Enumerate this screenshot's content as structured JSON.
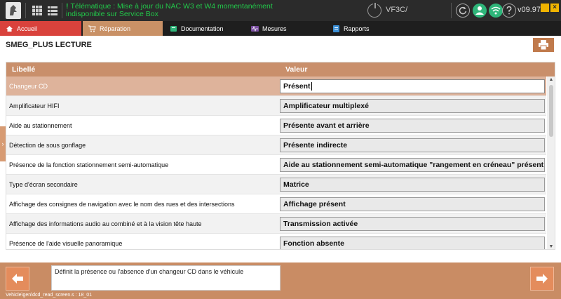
{
  "topbar": {
    "message": "Télématique : Mise à jour du NAC W3 et W4 momentanément indisponible sur Service Box",
    "message_prefix": "!",
    "vin": "VF3C/",
    "version": "v09.97",
    "close_glyph": "×",
    "icons": [
      "peugeot-logo",
      "grid-icon",
      "list-icon",
      "power-icon",
      "refresh-icon",
      "user-icon",
      "wifi-icon",
      "help-icon"
    ]
  },
  "tabs": [
    {
      "label": "Accueil",
      "icon": "home-icon",
      "active": false
    },
    {
      "label": "Réparation",
      "icon": "cart-icon",
      "active": true
    },
    {
      "label": "Documentation",
      "icon": "book-icon",
      "active": false
    },
    {
      "label": "Mesures",
      "icon": "waveform-icon",
      "active": false
    },
    {
      "label": "Rapports",
      "icon": "report-icon",
      "active": false
    }
  ],
  "page": {
    "title": "SMEG_PLUS LECTURE"
  },
  "table": {
    "headers": [
      "Libellé",
      "Valeur"
    ],
    "rows": [
      {
        "label": "Changeur CD",
        "value": "Présent"
      },
      {
        "label": "Amplificateur HIFI",
        "value": "Amplificateur multiplexé"
      },
      {
        "label": "Aide au stationnement",
        "value": "Présente avant et arrière"
      },
      {
        "label": "Détection de sous gonflage",
        "value": "Présente indirecte"
      },
      {
        "label": "Présence de la fonction stationnement semi-automatique",
        "value": "Aide au stationnement semi-automatique \"rangement en créneau\" présent"
      },
      {
        "label": "Type d'écran secondaire",
        "value": "Matrice"
      },
      {
        "label": "Affichage des consignes de navigation avec le nom des rues et des intersections",
        "value": "Affichage présent"
      },
      {
        "label": "Affichage des informations audio au combiné et à la vision tête haute",
        "value": "Transmission activée"
      },
      {
        "label": "Présence de l'aide visuelle panoramique",
        "value": "Fonction absente"
      }
    ]
  },
  "footer": {
    "help_text": "Définit la présence ou l'absence d'un changeur CD dans le véhicule",
    "path": "Vehicle\\gen\\dcd_read_screen.s : 18_01"
  },
  "colors": {
    "accent": "#c98f6b",
    "home_tab": "#d9423c",
    "active_tab": "#c99166",
    "selected_row": "#deb39b",
    "message": "#22c84a",
    "window_buttons": "#f0b400"
  }
}
